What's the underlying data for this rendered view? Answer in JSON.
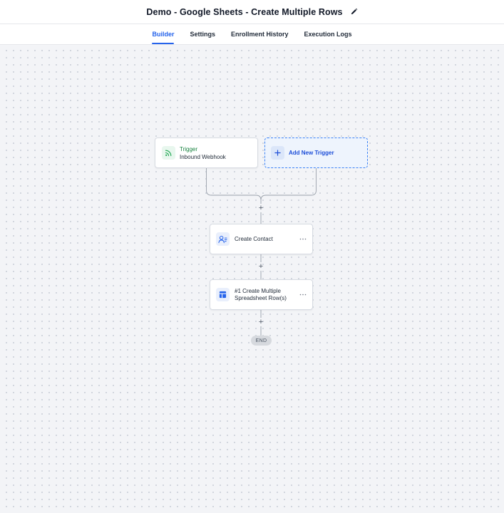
{
  "header": {
    "title": "Demo - Google Sheets - Create Multiple Rows",
    "edit_icon": "pencil-icon"
  },
  "tabs": [
    {
      "label": "Builder",
      "active": true
    },
    {
      "label": "Settings",
      "active": false
    },
    {
      "label": "Enrollment History",
      "active": false
    },
    {
      "label": "Execution Logs",
      "active": false
    }
  ],
  "workflow": {
    "trigger": {
      "label": "Trigger",
      "subtitle": "Inbound Webhook",
      "icon": "webhook-icon",
      "color": "#15803d"
    },
    "add_trigger": {
      "label": "Add New Trigger",
      "icon": "plus-icon",
      "color": "#1d4ed8"
    },
    "actions": [
      {
        "label": "Create Contact",
        "icon": "contact-icon"
      },
      {
        "label": "#1 Create Multiple Spreadsheet Row(s)",
        "icon": "spreadsheet-icon"
      }
    ],
    "add_step_symbol": "+",
    "end_label": "END"
  },
  "colors": {
    "accent": "#2563eb",
    "canvas_bg": "#f3f4f7"
  }
}
